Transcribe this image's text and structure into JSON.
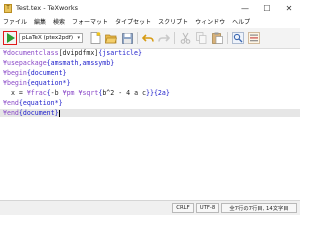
{
  "window": {
    "title": "Test.tex - TeXworks",
    "app_icon_glyph": "T",
    "minimize_glyph": "—",
    "maximize_glyph": "☐",
    "close_glyph": "✕"
  },
  "menu": [
    "ファイル",
    "編集",
    "検索",
    "フォーマット",
    "タイプセット",
    "スクリプト",
    "ウィンドウ",
    "ヘルプ"
  ],
  "toolbar": {
    "engine_selected": "pLaTeX (ptex2pdf)",
    "engine_arrow": "▾",
    "buttons": [
      "new-document",
      "open-folder",
      "save",
      "undo",
      "redo",
      "cut",
      "copy",
      "paste",
      "search",
      "replace"
    ]
  },
  "editor": {
    "lines": [
      [
        {
          "t": "¥documentclass",
          "c": "cmd"
        },
        {
          "t": "[dvipdfmx]",
          "c": "plain"
        },
        {
          "t": "{jsarticle}",
          "c": "arg"
        }
      ],
      [
        {
          "t": "¥usepackage",
          "c": "cmd"
        },
        {
          "t": "{amsmath,amssymb}",
          "c": "arg"
        }
      ],
      [
        {
          "t": "¥begin",
          "c": "cmd"
        },
        {
          "t": "{document}",
          "c": "arg"
        }
      ],
      [
        {
          "t": "¥begin",
          "c": "cmd"
        },
        {
          "t": "{equation*}",
          "c": "arg"
        }
      ],
      [
        {
          "t": "  x = ",
          "c": "plain"
        },
        {
          "t": "¥frac",
          "c": "cmd"
        },
        {
          "t": "{",
          "c": "arg"
        },
        {
          "t": "-b ",
          "c": "plain"
        },
        {
          "t": "¥pm ",
          "c": "cmd"
        },
        {
          "t": "¥sqrt",
          "c": "cmd"
        },
        {
          "t": "{",
          "c": "arg"
        },
        {
          "t": "b^2 - 4 a c",
          "c": "plain"
        },
        {
          "t": "}}{2a}",
          "c": "arg"
        }
      ],
      [
        {
          "t": "¥end",
          "c": "cmd"
        },
        {
          "t": "{equation*}",
          "c": "arg"
        }
      ],
      [
        {
          "t": "¥end",
          "c": "cmd"
        },
        {
          "t": "{document}",
          "c": "arg"
        }
      ]
    ],
    "current_line_index": 6
  },
  "status": {
    "line_ending": "CRLF",
    "encoding": "UTF-8",
    "position": "全7行の7行目, 14文字目"
  },
  "colors": {
    "run_button_border": "#e11a1a",
    "run_triangle": "#2c9d31",
    "command": "#8a48c8",
    "argument": "#2222cc",
    "current_line": "#e6e6e6"
  }
}
